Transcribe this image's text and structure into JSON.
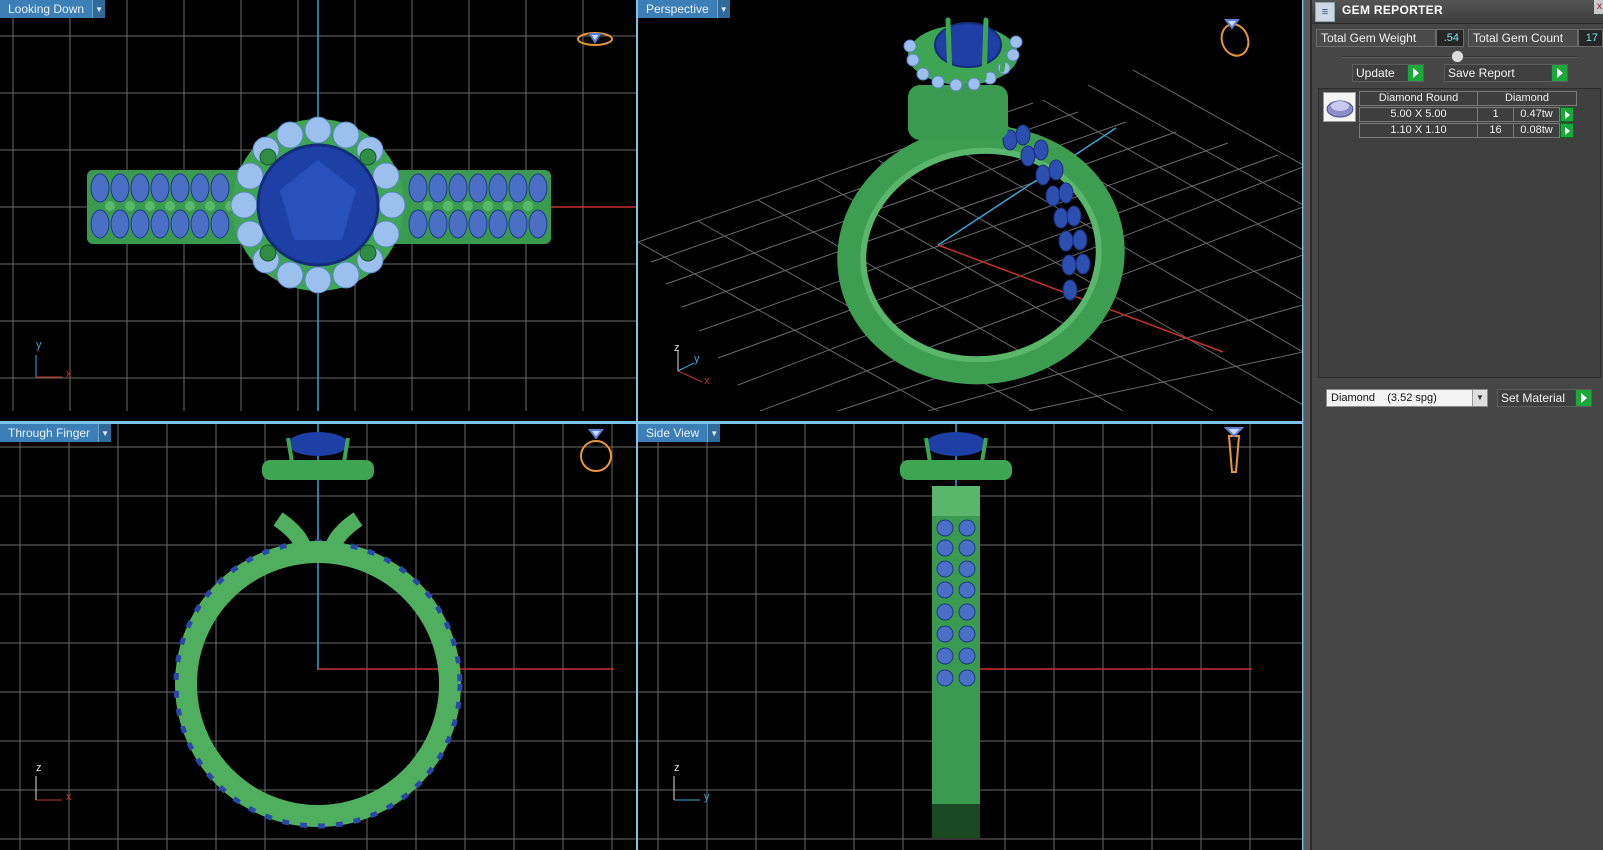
{
  "viewports": {
    "top_left": {
      "label": "Looking Down"
    },
    "top_right": {
      "label": "Perspective"
    },
    "bottom_left": {
      "label": "Through Finger"
    },
    "bottom_right": {
      "label": "Side View"
    }
  },
  "axes": {
    "x": "x",
    "y": "y",
    "z": "z"
  },
  "panel": {
    "title": "GEM REPORTER",
    "logo": "≡",
    "close": "x",
    "total_weight_label": "Total Gem Weight",
    "total_weight_value": ".54",
    "total_count_label": "Total Gem Count",
    "total_count_value": "17",
    "update_label": "Update",
    "save_report_label": "Save Report",
    "table": {
      "headers": [
        "Diamond Round",
        "Diamond"
      ],
      "rows": [
        {
          "size": "5.00 X 5.00",
          "count": "1",
          "weight": "0.47tw"
        },
        {
          "size": "1.10 X 1.10",
          "count": "16",
          "weight": "0.08tw"
        }
      ]
    },
    "material_select": "Diamond    (3.52 spg)",
    "set_material_label": "Set Material"
  },
  "colors": {
    "metal": "#3fa554",
    "stone": "#1e3fa6",
    "accent_stone": "#9cc0ee",
    "grid": "#6c6c6c",
    "divider": "#7dc3e8"
  }
}
